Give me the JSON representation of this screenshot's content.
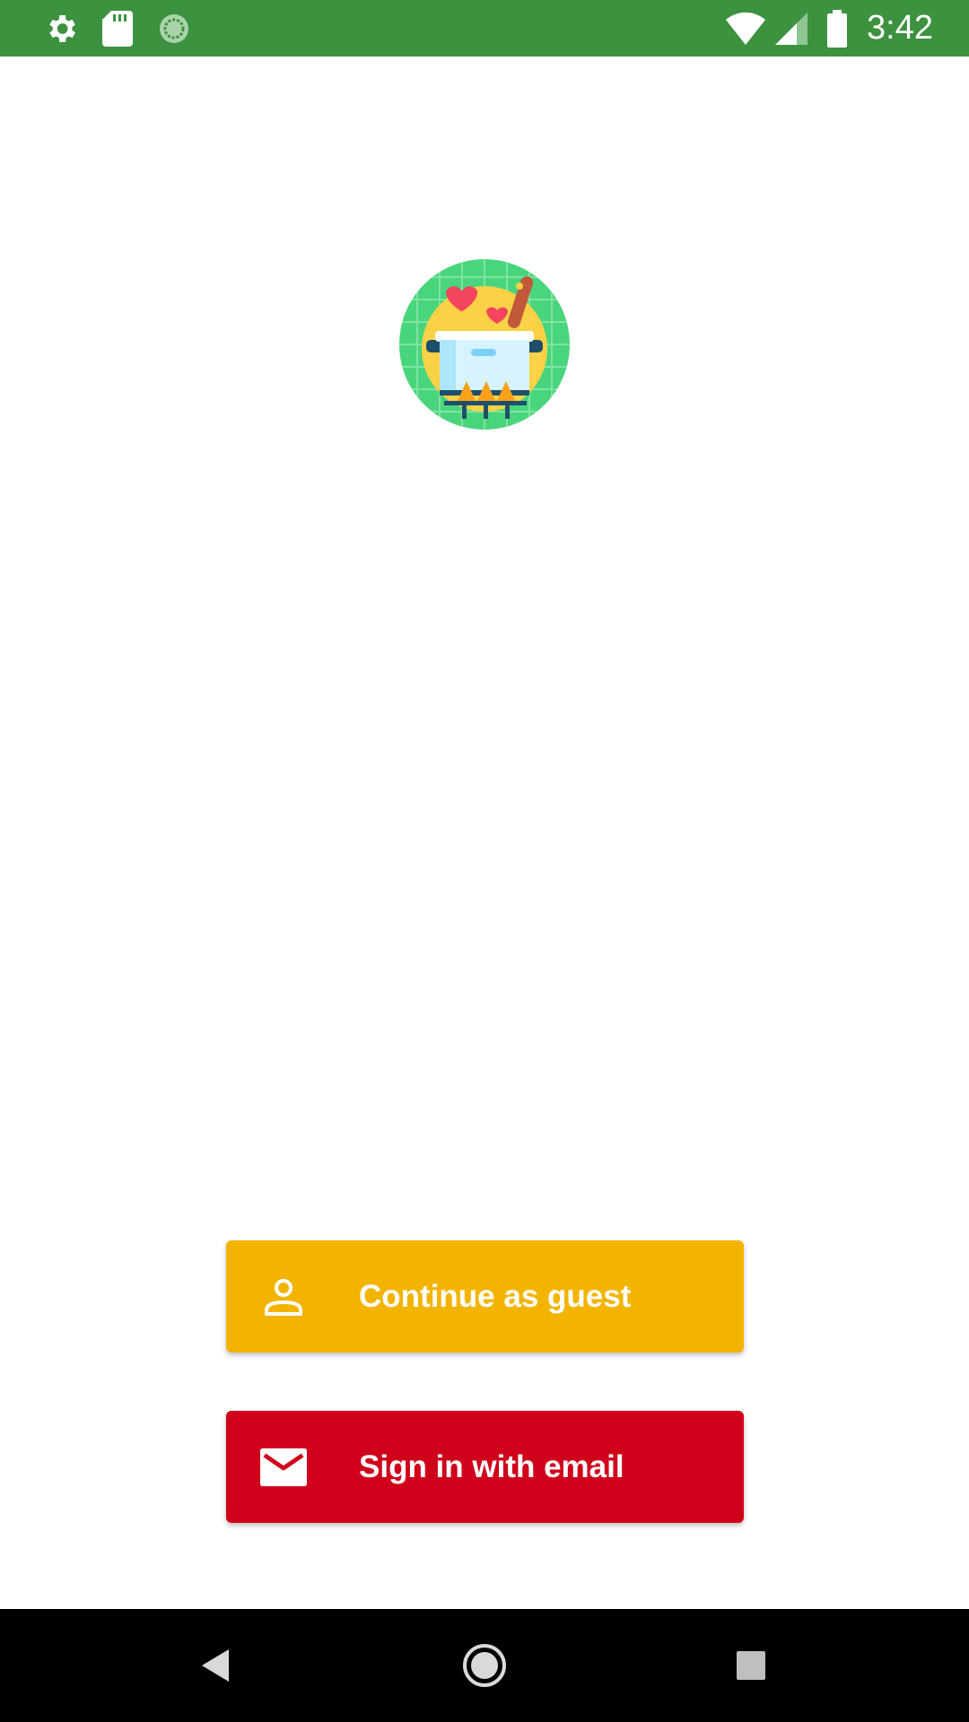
{
  "status_bar": {
    "time": "3:42",
    "icons": [
      "gear-icon",
      "sd-card-icon",
      "sync-icon",
      "wifi-icon",
      "signal-icon",
      "battery-icon"
    ]
  },
  "logo": {
    "icon": "cooking-pot-icon"
  },
  "buttons": {
    "guest": {
      "label": "Continue as guest",
      "icon": "person-icon",
      "color": "#f3b400"
    },
    "email": {
      "label": "Sign in with email",
      "icon": "mail-icon",
      "color": "#d0021b"
    }
  },
  "nav_bar": {
    "icons": [
      "back-icon",
      "home-icon",
      "recents-icon"
    ]
  },
  "colors": {
    "status_bar": "#3c923f",
    "logo_bg": "#49d57c"
  }
}
